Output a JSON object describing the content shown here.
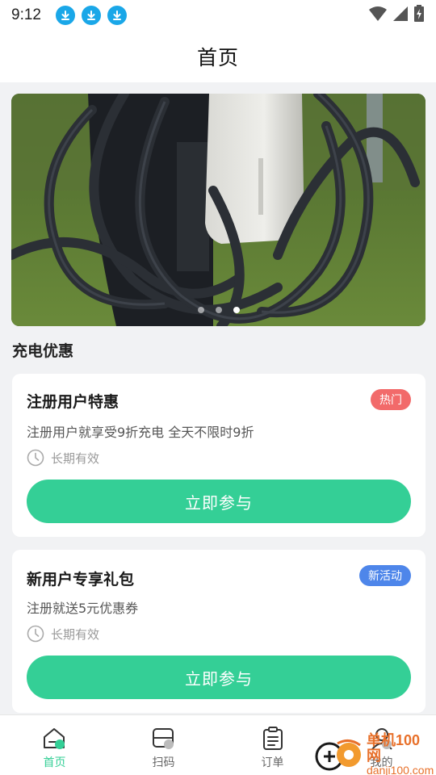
{
  "status_bar": {
    "time": "9:12",
    "download_icons": [
      "download-icon",
      "download-icon",
      "download-icon"
    ],
    "right_icons": [
      "wifi-icon",
      "signal-icon",
      "battery-charging-icon"
    ]
  },
  "header": {
    "title": "首页"
  },
  "banner": {
    "image": "ev-charger-with-cables-on-grass",
    "slides": 3,
    "active_slide": 3
  },
  "section": {
    "title": "充电优惠"
  },
  "promotions": [
    {
      "title": "注册用户特惠",
      "badge": "热门",
      "badge_color": "#f26a6a",
      "description": "注册用户就享受9折充电 全天不限时9折",
      "validity": "长期有效",
      "button": "立即参与"
    },
    {
      "title": "新用户专享礼包",
      "badge": "新活动",
      "badge_color": "#4e86ea",
      "description": "注册就送5元优惠券",
      "validity": "长期有效",
      "button": "立即参与"
    }
  ],
  "tab_bar": {
    "items": [
      {
        "label": "首页",
        "icon": "home-icon",
        "active": true
      },
      {
        "label": "扫码",
        "icon": "scan-icon",
        "active": false
      },
      {
        "label": "订单",
        "icon": "order-icon",
        "active": false
      },
      {
        "label": "我的",
        "icon": "profile-icon",
        "active": false
      }
    ]
  },
  "watermark": {
    "line1": "单机100网",
    "line2": "danji100.com"
  },
  "colors": {
    "accent": "#34cf96",
    "hot_badge": "#f26a6a",
    "new_badge": "#4e86ea"
  }
}
